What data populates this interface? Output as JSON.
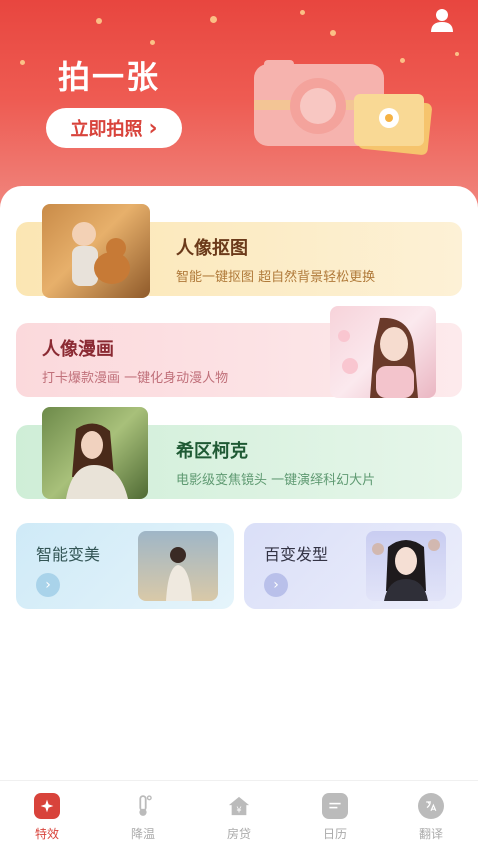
{
  "hero": {
    "title": "拍一张",
    "button_label": "立即拍照",
    "button_arrow": "›"
  },
  "cards": [
    {
      "title": "人像抠图",
      "subtitle": "智能一键抠图 超自然背景轻松更换",
      "icon": "portrait-photo"
    },
    {
      "title": "人像漫画",
      "subtitle": "打卡爆款漫画  一键化身动漫人物",
      "icon": "portrait-photo"
    },
    {
      "title": "希区柯克",
      "subtitle": "电影级变焦镜头  一键演绎科幻大片",
      "icon": "portrait-photo"
    }
  ],
  "small_cards": [
    {
      "title": "智能变美",
      "arrow": "›"
    },
    {
      "title": "百变发型",
      "arrow": "›"
    }
  ],
  "tabs": [
    {
      "label": "特效",
      "active": true,
      "icon": "sparkle-icon"
    },
    {
      "label": "降温",
      "active": false,
      "icon": "thermometer-icon"
    },
    {
      "label": "房贷",
      "active": false,
      "icon": "house-loan-icon"
    },
    {
      "label": "日历",
      "active": false,
      "icon": "calendar-icon"
    },
    {
      "label": "翻译",
      "active": false,
      "icon": "translate-icon"
    }
  ],
  "colors": {
    "brand_red": "#e8463f",
    "active_tab": "#d8433b"
  }
}
